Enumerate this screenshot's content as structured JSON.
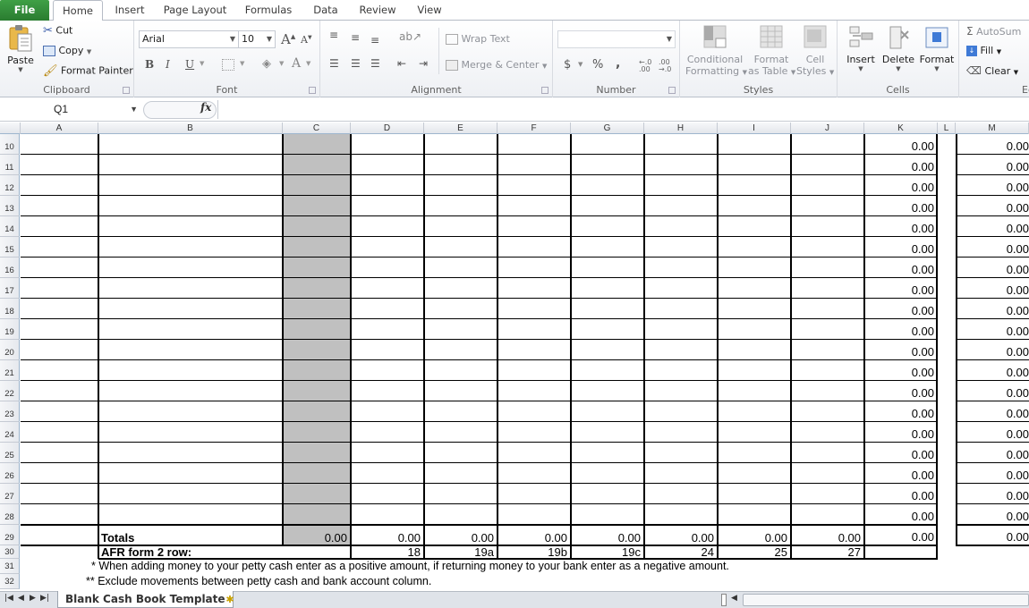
{
  "ribbon_tabs": [
    "File",
    "Home",
    "Insert",
    "Page Layout",
    "Formulas",
    "Data",
    "Review",
    "View"
  ],
  "active_tab": "Home",
  "clipboard": {
    "paste": "Paste",
    "cut": "Cut",
    "copy": "Copy",
    "format_painter": "Format Painter",
    "label": "Clipboard"
  },
  "font": {
    "name": "Arial",
    "size": "10",
    "label": "Font",
    "bold": "B",
    "italic": "I",
    "underline": "U"
  },
  "alignment": {
    "wrap_text": "Wrap Text",
    "merge_center": "Merge & Center",
    "label": "Alignment"
  },
  "number": {
    "format": "",
    "currency": "$",
    "percent": "%",
    "comma": ",",
    "inc_decimal": "+.0 .00",
    "dec_decimal": ".00 +.0",
    "label": "Number"
  },
  "styles": {
    "conditional_1": "Conditional",
    "conditional_2": "Formatting",
    "format_table_1": "Format",
    "format_table_2": "as Table",
    "cell_styles_1": "Cell",
    "cell_styles_2": "Styles",
    "label": "Styles"
  },
  "cells": {
    "insert": "Insert",
    "delete": "Delete",
    "format": "Format",
    "label": "Cells"
  },
  "editing": {
    "autosum": "AutoSum",
    "fill": "Fill",
    "clear": "Clear",
    "label": "Ed"
  },
  "formula_bar": {
    "name_box": "Q1",
    "fx": "fx",
    "formula": ""
  },
  "columns": [
    "A",
    "B",
    "C",
    "D",
    "E",
    "F",
    "G",
    "H",
    "I",
    "J",
    "K",
    "L",
    "M"
  ],
  "rows": [
    10,
    11,
    12,
    13,
    14,
    15,
    16,
    17,
    18,
    19,
    20,
    21,
    22,
    23,
    24,
    25,
    26,
    27,
    28,
    29,
    30,
    31,
    32
  ],
  "k_values": [
    "0.00",
    "0.00",
    "0.00",
    "0.00",
    "0.00",
    "0.00",
    "0.00",
    "0.00",
    "0.00",
    "0.00",
    "0.00",
    "0.00",
    "0.00",
    "0.00",
    "0.00",
    "0.00",
    "0.00",
    "0.00",
    "0.00",
    "0.00"
  ],
  "m_values": [
    "0.00",
    "0.00",
    "0.00",
    "0.00",
    "0.00",
    "0.00",
    "0.00",
    "0.00",
    "0.00",
    "0.00",
    "0.00",
    "0.00",
    "0.00",
    "0.00",
    "0.00",
    "0.00",
    "0.00",
    "0.00",
    "0.00",
    "0.00"
  ],
  "totals_row": {
    "label": "Totals",
    "C": "0.00",
    "D": "0.00",
    "E": "0.00",
    "F": "0.00",
    "G": "0.00",
    "H": "0.00",
    "I": "0.00",
    "J": "0.00"
  },
  "afr_row": {
    "label": "AFR form 2 row:",
    "D": "18",
    "E": "19a",
    "F": "19b",
    "G": "19c",
    "H": "24",
    "I": "25",
    "J": "27"
  },
  "notes": [
    "* When adding money to your petty cash enter as a positive amount, if returning money to your bank enter as a negative amount.",
    "** Exclude movements between petty cash and bank account column."
  ],
  "sheet_tab": "Blank Cash Book Template"
}
